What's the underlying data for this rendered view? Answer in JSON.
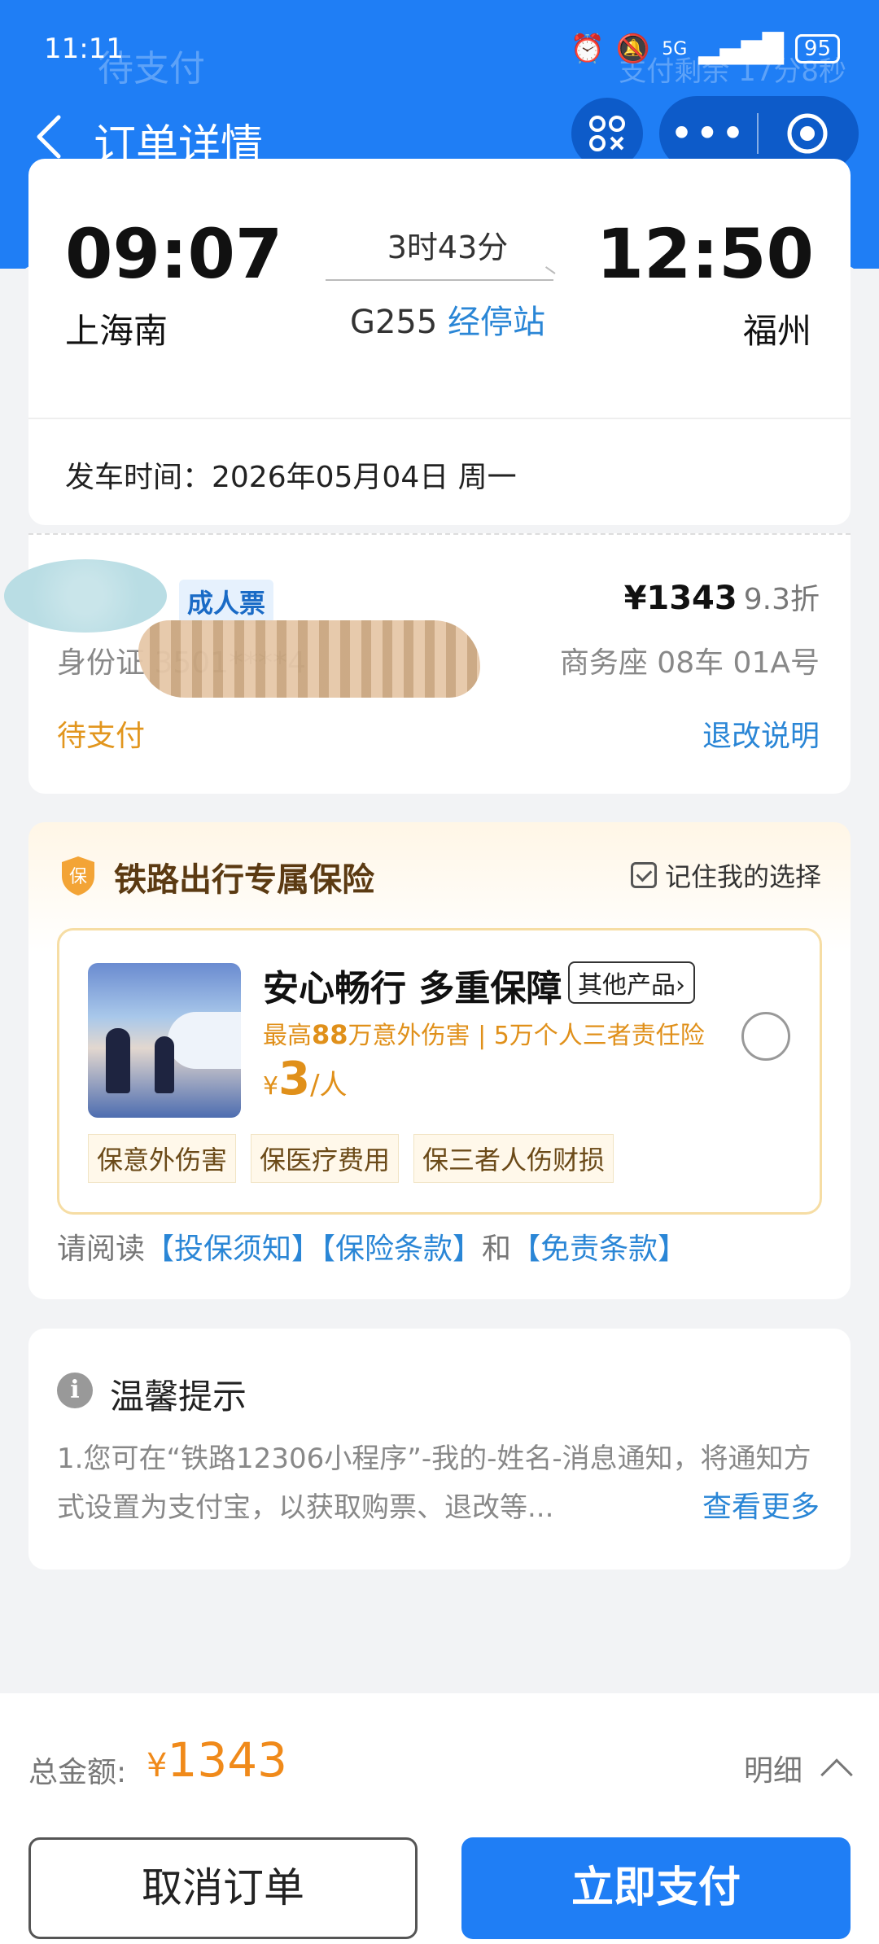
{
  "status_bar": {
    "time": "11:11",
    "signal": "5G",
    "battery": "95"
  },
  "ghost_header": {
    "left": "待支付",
    "right": "支付剩余 17分8秒"
  },
  "nav": {
    "title": "订单详情"
  },
  "trip": {
    "dep_time": "09:07",
    "dep_station": "上海南",
    "arr_time": "12:50",
    "arr_station": "福州",
    "duration": "3时43分",
    "train_no": "G255",
    "stops_link": "经停站",
    "depart_date": "发车时间：2026年05月04日 周一"
  },
  "passenger": {
    "ticket_type": "成人票",
    "price": "¥1343",
    "discount": "9.3折",
    "id_label": "身份证 3501****4",
    "seat": "商务座 08车 01A号",
    "status": "待支付",
    "refund_link": "退改说明"
  },
  "insurance": {
    "title": "铁路出行专属保险",
    "remember": "记住我的选择",
    "product_name": "安心畅行 多重保障",
    "other_products": "其他产品",
    "desc_prefix": "最高",
    "desc_amount": "88",
    "desc_suffix": "万意外伤害 | 5万个人三者责任险",
    "price_yen": "¥",
    "price_num": "3",
    "price_unit": "/人",
    "tags": [
      "保意外伤害",
      "保医疗费用",
      "保三者人伤财损"
    ],
    "read_prefix": "请阅读",
    "link1": "【投保须知】",
    "link2": "【保险条款】",
    "read_and": "和",
    "link3": "【免责条款】"
  },
  "tips": {
    "title": "温馨提示",
    "text": "1.您可在“铁路12306小程序”-我的-姓名-消息通知，将通知方式设置为支付宝，以获取购票、退改等...",
    "more": "查看更多"
  },
  "bottom": {
    "total_label": "总金额:",
    "total_yen": "¥",
    "total_value": "1343",
    "detail": "明细",
    "cancel": "取消订单",
    "pay": "立即支付"
  },
  "colors": {
    "brand": "#1f7ef5",
    "accent_orange": "#f08a1a",
    "link_blue": "#2a86d6"
  }
}
